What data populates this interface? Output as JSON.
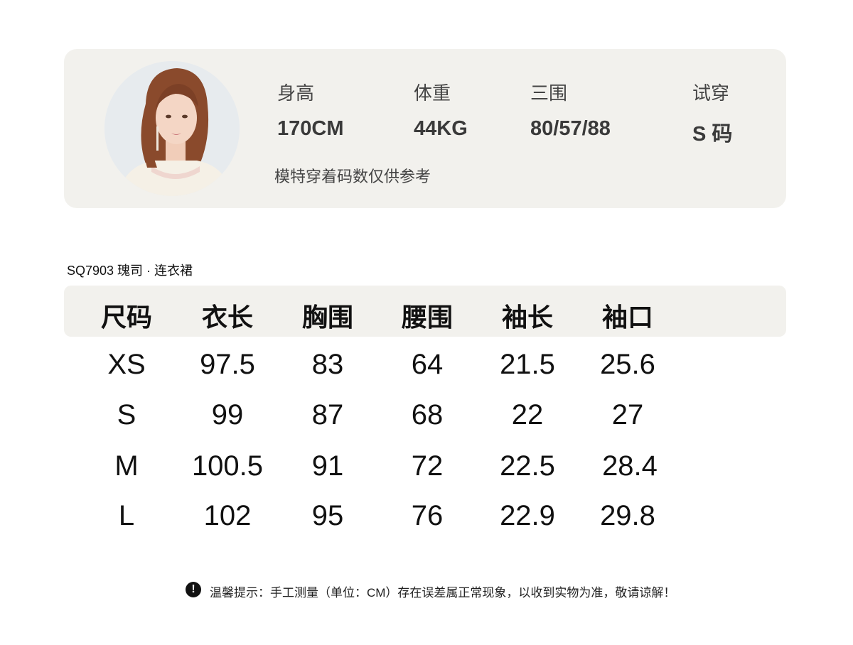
{
  "model": {
    "stats": [
      {
        "label": "身高",
        "value": "170CM"
      },
      {
        "label": "体重",
        "value": "44KG"
      },
      {
        "label": "三围",
        "value": "80/57/88"
      },
      {
        "label": "试穿",
        "value": "S 码"
      }
    ],
    "note": "模特穿着码数仅供参考"
  },
  "product": {
    "title": "SQ7903  瑰司 · 连衣裙"
  },
  "size_table": {
    "headers": [
      "尺码",
      "衣长",
      "胸围",
      "腰围",
      "袖长",
      "袖口"
    ],
    "rows": [
      [
        "XS",
        "97.5",
        "83",
        "64",
        "21.5",
        "25.6"
      ],
      [
        "S",
        "99",
        "87",
        "68",
        "22",
        "27"
      ],
      [
        "M",
        "100.5",
        "91",
        "72",
        "22.5",
        "28.4"
      ],
      [
        "L",
        "102",
        "95",
        "76",
        "22.9",
        "29.8"
      ]
    ]
  },
  "tip": {
    "icon": "exclamation-icon",
    "icon_glyph": "!",
    "text": "温馨提示：手工测量（单位：CM）存在误差属正常现象，以收到实物为准，敬请谅解！"
  }
}
